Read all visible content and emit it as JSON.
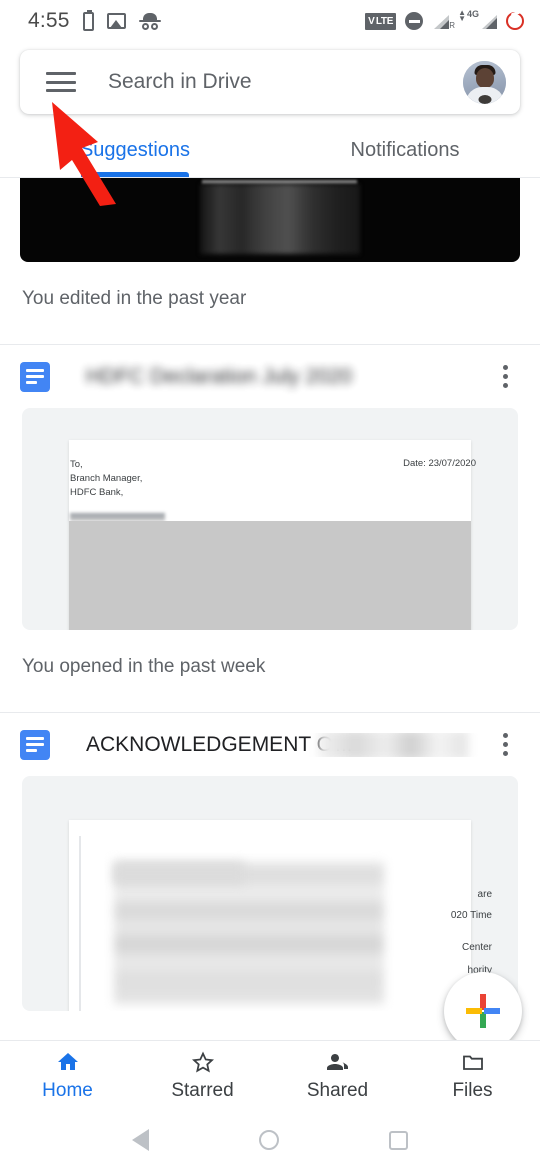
{
  "statusbar": {
    "time": "4:55",
    "icons_left": [
      "battery-icon",
      "photo-icon",
      "incognito-icon"
    ],
    "volte_label": "V LTE",
    "network_label": "4G",
    "signal_r_label": "R",
    "icons_right": [
      "volte-icon",
      "do-not-disturb-icon",
      "signal-bars-icon",
      "signal-bars-4g-icon",
      "alarm-ring-icon"
    ]
  },
  "search": {
    "placeholder": "Search in Drive",
    "menu_icon": "hamburger-menu-icon",
    "avatar_label": "account-avatar"
  },
  "tabs": [
    {
      "label": "Suggestions",
      "active": true
    },
    {
      "label": "Notifications",
      "active": false
    }
  ],
  "cards": [
    {
      "id": "card-clipped",
      "title": "",
      "meta": "You edited in the past year",
      "thumb_type": "black-image",
      "blurred_title": true
    },
    {
      "id": "card-hdfc",
      "title": "HDFC Declaration July 2020",
      "blurred_title": true,
      "meta": "You opened in the past week",
      "preview": {
        "lines_left": [
          "To,",
          "Branch Manager,",
          "HDFC Bank,"
        ],
        "line_right": "Date: 23/07/2020"
      }
    },
    {
      "id": "card-acknowledgement",
      "title": "ACKNOWLEDGEMENT O",
      "title_overflow": "...",
      "blurred_title": true,
      "meta": "",
      "preview": {
        "fragments": [
          "are",
          "020 Time",
          "Center",
          "hority"
        ]
      }
    }
  ],
  "fab": {
    "label": "create-new",
    "icon": "google-plus-icon"
  },
  "bottom_nav": [
    {
      "label": "Home",
      "icon": "home-icon",
      "active": true
    },
    {
      "label": "Starred",
      "icon": "star-icon",
      "active": false
    },
    {
      "label": "Shared",
      "icon": "people-icon",
      "active": false
    },
    {
      "label": "Files",
      "icon": "folder-icon",
      "active": false
    }
  ],
  "android_nav": [
    {
      "label": "Back",
      "icon": "triangle-back-icon"
    },
    {
      "label": "Home",
      "icon": "circle-home-icon"
    },
    {
      "label": "Recents",
      "icon": "square-recents-icon"
    }
  ],
  "annotation": {
    "type": "red-arrow",
    "points_to": "hamburger-menu-icon",
    "color": "#f32013"
  },
  "colors": {
    "accent": "#1a73e8",
    "docs_blue": "#4285f4",
    "text_primary": "#202124",
    "text_secondary": "#5f6368",
    "divider": "#e8eaed",
    "arrow_red": "#f32013"
  }
}
